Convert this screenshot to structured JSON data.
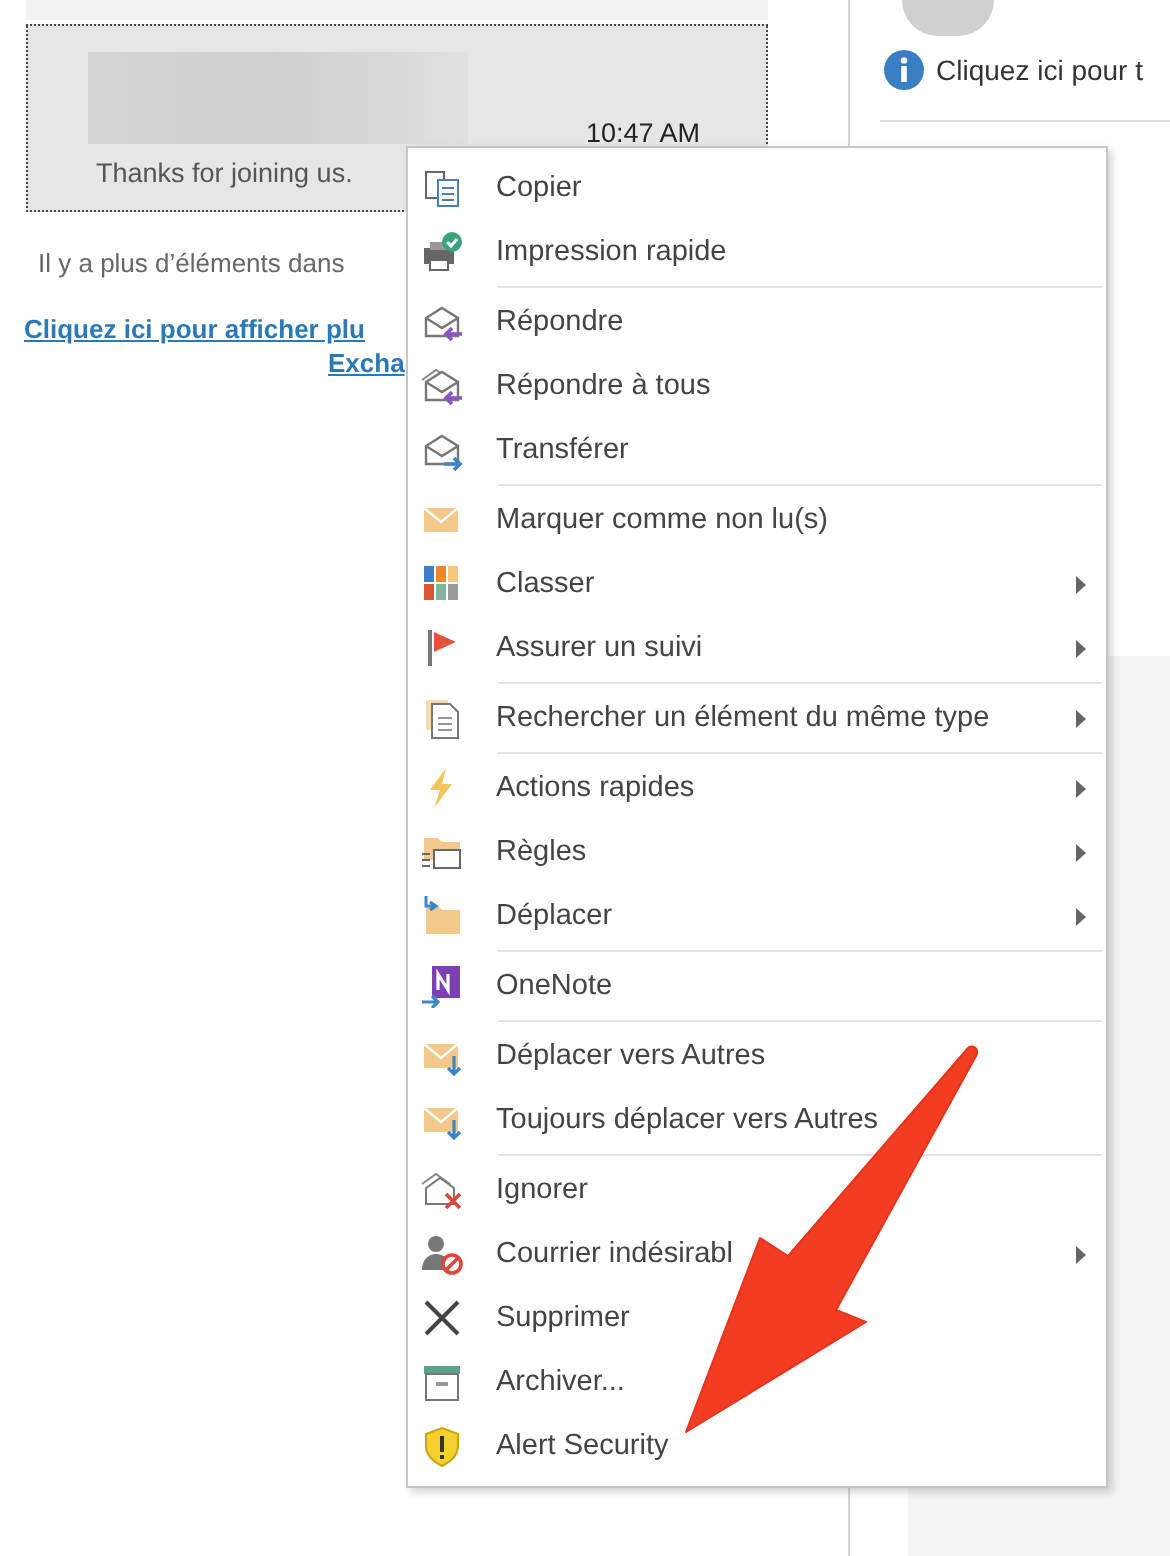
{
  "message_list": {
    "message": {
      "preview": "Thanks for joining us.",
      "time": "10:47 AM",
      "selected": true
    },
    "more_items_notice": "Il y a plus d’éléments dans",
    "more_items_link": [
      "Cliquez ici pour afficher plu",
      "Excha"
    ]
  },
  "reading_pane": {
    "info_text": "Cliquez ici pour t"
  },
  "context_menu": {
    "sections": [
      {
        "items": [
          {
            "label": "Copier",
            "submenu": false
          },
          {
            "label": "Impression rapide",
            "submenu": false
          }
        ]
      },
      {
        "items": [
          {
            "label": "Répondre",
            "submenu": false
          },
          {
            "label": "Répondre à tous",
            "submenu": false
          },
          {
            "label": "Transférer",
            "submenu": false
          }
        ]
      },
      {
        "items": [
          {
            "label": "Marquer comme non lu(s)",
            "submenu": false
          },
          {
            "label": "Classer",
            "submenu": true
          },
          {
            "label": "Assurer un suivi",
            "submenu": true
          }
        ]
      },
      {
        "items": [
          {
            "label": "Rechercher un élément du même type",
            "submenu": true
          }
        ]
      },
      {
        "items": [
          {
            "label": "Actions rapides",
            "submenu": true
          },
          {
            "label": "Règles",
            "submenu": true
          },
          {
            "label": "Déplacer",
            "submenu": true
          }
        ]
      },
      {
        "items": [
          {
            "label": "OneNote",
            "submenu": false
          }
        ]
      },
      {
        "items": [
          {
            "label": "Déplacer vers Autres",
            "submenu": false
          },
          {
            "label": "Toujours déplacer vers Autres",
            "submenu": false
          }
        ]
      },
      {
        "items": [
          {
            "label": "Ignorer",
            "submenu": false
          },
          {
            "label": "Courrier indésirabl",
            "submenu": true
          },
          {
            "label": "Supprimer",
            "submenu": false
          },
          {
            "label": "Archiver...",
            "submenu": false
          },
          {
            "label": "Alert Security",
            "submenu": false
          }
        ]
      }
    ]
  },
  "annotation": {
    "kind": "arrow"
  }
}
